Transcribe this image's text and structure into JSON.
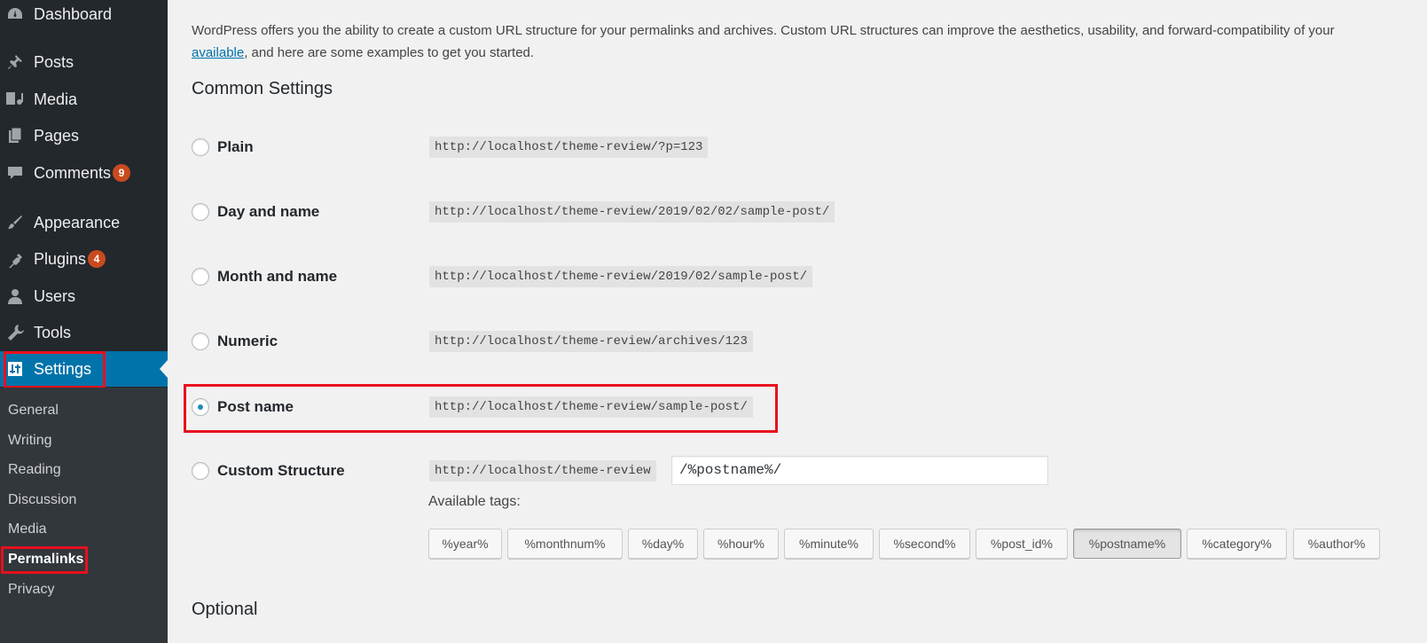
{
  "sidebar": {
    "menu": [
      {
        "label": "Dashboard",
        "icon": "dashboard-icon"
      },
      {
        "label": "Posts",
        "icon": "pin-icon"
      },
      {
        "label": "Media",
        "icon": "media-icon"
      },
      {
        "label": "Pages",
        "icon": "pages-icon"
      },
      {
        "label": "Comments",
        "icon": "comment-icon",
        "badge": "9"
      },
      {
        "label": "Appearance",
        "icon": "paintbrush-icon"
      },
      {
        "label": "Plugins",
        "icon": "plugin-icon",
        "badge": "4"
      },
      {
        "label": "Users",
        "icon": "user-icon"
      },
      {
        "label": "Tools",
        "icon": "wrench-icon"
      },
      {
        "label": "Settings",
        "icon": "settings-icon",
        "current": true
      }
    ],
    "submenu": [
      "General",
      "Writing",
      "Reading",
      "Discussion",
      "Media",
      "Permalinks",
      "Privacy"
    ],
    "current_submenu": "Permalinks"
  },
  "main": {
    "intro_line1": "WordPress offers you the ability to create a custom URL structure for your permalinks and archives. Custom URL structures can improve the aesthetics, usability, and forward-compatibility of your",
    "intro_link": "available",
    "intro_line2_rest": ", and here are some examples to get you started.",
    "common_settings_title": "Common Settings",
    "options": [
      {
        "label": "Plain",
        "example": "http://localhost/theme-review/?p=123",
        "checked": false
      },
      {
        "label": "Day and name",
        "example": "http://localhost/theme-review/2019/02/02/sample-post/",
        "checked": false
      },
      {
        "label": "Month and name",
        "example": "http://localhost/theme-review/2019/02/sample-post/",
        "checked": false
      },
      {
        "label": "Numeric",
        "example": "http://localhost/theme-review/archives/123",
        "checked": false
      },
      {
        "label": "Post name",
        "example": "http://localhost/theme-review/sample-post/",
        "checked": true
      },
      {
        "label": "Custom Structure",
        "example": "http://localhost/theme-review",
        "checked": false
      }
    ],
    "custom_structure_value": "/%postname%/",
    "available_tags_label": "Available tags:",
    "tags": [
      "%year%",
      "%monthnum%",
      "%day%",
      "%hour%",
      "%minute%",
      "%second%",
      "%post_id%",
      "%postname%",
      "%category%",
      "%author%"
    ],
    "active_tag": "%postname%",
    "optional_title": "Optional"
  },
  "colors": {
    "sidebar_bg": "#23282d",
    "submenu_bg": "#32373c",
    "accent": "#0073aa",
    "badge": "#ca4a1f",
    "highlight_box": "#e8101e"
  }
}
